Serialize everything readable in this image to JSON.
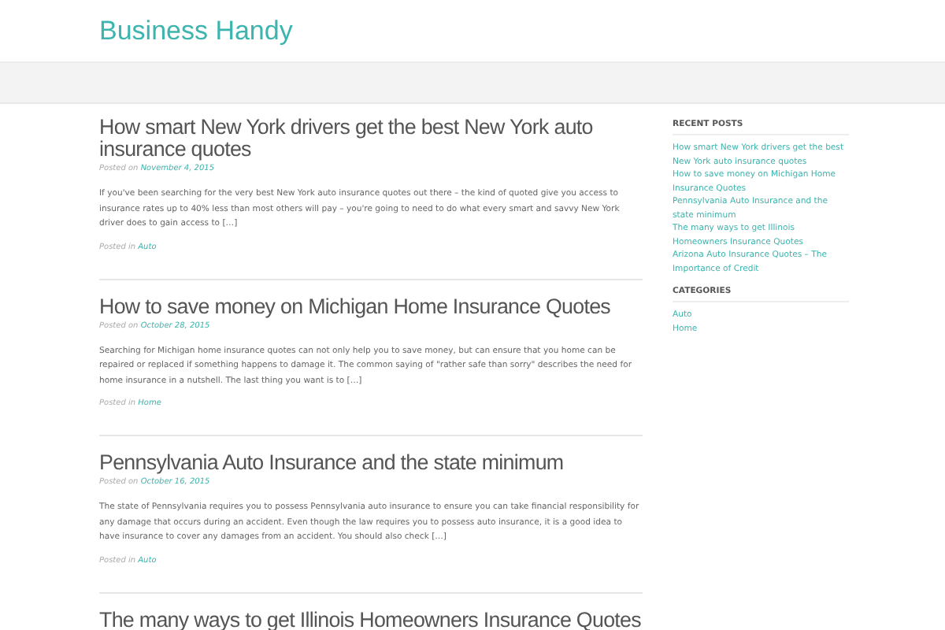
{
  "site": {
    "title": "Business Handy"
  },
  "posts": [
    {
      "title": "How smart New York drivers get the best New York auto insurance quotes",
      "posted_on_label": "Posted on",
      "date": "November 4, 2015",
      "excerpt": "If you've been searching for the very best New York auto insurance quotes out there – the kind of quoted give you access to insurance rates up to 40% less than most others will pay – you're going to need to do what every smart and savvy New York driver does to gain access to […]",
      "posted_in_label": "Posted in",
      "category": "Auto"
    },
    {
      "title": "How to save money on Michigan Home Insurance Quotes",
      "posted_on_label": "Posted on",
      "date": "October 28, 2015",
      "excerpt": "Searching for Michigan home insurance quotes can not only help you to save money, but can ensure that you home can be repaired or replaced if something happens to damage it. The common saying of \"rather safe than sorry\" describes the need for home insurance in a nutshell. The last thing you want is to […]",
      "posted_in_label": "Posted in",
      "category": "Home"
    },
    {
      "title": "Pennsylvania Auto Insurance and the state minimum",
      "posted_on_label": "Posted on",
      "date": "October 16, 2015",
      "excerpt": "The state of Pennsylvania requires you to possess Pennsylvania auto insurance to ensure you can take financial responsibility for any damage that occurs during an accident. Even though the law requires you to possess auto insurance, it is a good idea to have insurance to cover any damages from an accident. You should also check […]",
      "posted_in_label": "Posted in",
      "category": "Auto"
    },
    {
      "title": "The many ways to get Illinois Homeowners Insurance Quotes"
    }
  ],
  "sidebar": {
    "recent_posts": {
      "heading": "RECENT POSTS",
      "items": [
        "How smart New York drivers get the best New York auto insurance quotes",
        "How to save money on Michigan Home Insurance Quotes",
        "Pennsylvania Auto Insurance and the state minimum",
        "The many ways to get Illinois Homeowners Insurance Quotes",
        "Arizona Auto Insurance Quotes – The Importance of Credit"
      ]
    },
    "categories": {
      "heading": "CATEGORIES",
      "items": [
        "Auto",
        "Home"
      ]
    }
  }
}
